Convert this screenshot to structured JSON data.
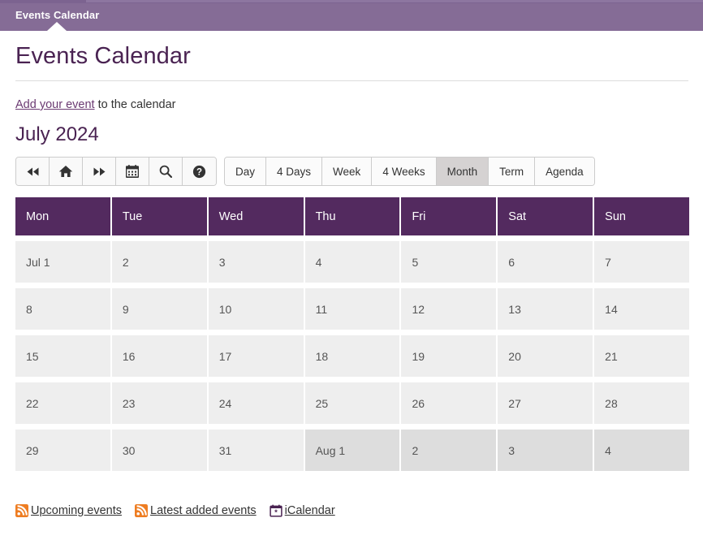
{
  "topbar": {
    "tab_label": "Events Calendar",
    "background_color": "#856c96"
  },
  "page": {
    "title": "Events Calendar",
    "add_event_link": "Add your event",
    "add_event_suffix": " to the calendar",
    "month_title": "July 2024",
    "heading_color": "#4a2352"
  },
  "icon_toolbar": {
    "buttons": [
      {
        "name": "previous-button",
        "icon": "fast-backward-icon"
      },
      {
        "name": "home-button",
        "icon": "home-icon"
      },
      {
        "name": "next-button",
        "icon": "fast-forward-icon"
      },
      {
        "name": "date-picker-button",
        "icon": "calendar-icon"
      },
      {
        "name": "search-button",
        "icon": "search-icon"
      },
      {
        "name": "help-button",
        "icon": "help-circle-icon"
      }
    ]
  },
  "view_toolbar": {
    "buttons": [
      {
        "label": "Day",
        "active": false
      },
      {
        "label": "4 Days",
        "active": false
      },
      {
        "label": "Week",
        "active": false
      },
      {
        "label": "4 Weeks",
        "active": false
      },
      {
        "label": "Month",
        "active": true
      },
      {
        "label": "Term",
        "active": false
      },
      {
        "label": "Agenda",
        "active": false
      }
    ],
    "active_background": "#d5d2d2"
  },
  "calendar": {
    "header_color": "#532a5f",
    "day_headers": [
      "Mon",
      "Tue",
      "Wed",
      "Thu",
      "Fri",
      "Sat",
      "Sun"
    ],
    "weeks": [
      [
        {
          "label": "Jul 1",
          "other_month": false
        },
        {
          "label": "2",
          "other_month": false
        },
        {
          "label": "3",
          "other_month": false
        },
        {
          "label": "4",
          "other_month": false
        },
        {
          "label": "5",
          "other_month": false
        },
        {
          "label": "6",
          "other_month": false
        },
        {
          "label": "7",
          "other_month": false
        }
      ],
      [
        {
          "label": "8",
          "other_month": false
        },
        {
          "label": "9",
          "other_month": false
        },
        {
          "label": "10",
          "other_month": false
        },
        {
          "label": "11",
          "other_month": false
        },
        {
          "label": "12",
          "other_month": false
        },
        {
          "label": "13",
          "other_month": false
        },
        {
          "label": "14",
          "other_month": false
        }
      ],
      [
        {
          "label": "15",
          "other_month": false
        },
        {
          "label": "16",
          "other_month": false
        },
        {
          "label": "17",
          "other_month": false
        },
        {
          "label": "18",
          "other_month": false
        },
        {
          "label": "19",
          "other_month": false
        },
        {
          "label": "20",
          "other_month": false
        },
        {
          "label": "21",
          "other_month": false
        }
      ],
      [
        {
          "label": "22",
          "other_month": false
        },
        {
          "label": "23",
          "other_month": false
        },
        {
          "label": "24",
          "other_month": false
        },
        {
          "label": "25",
          "other_month": false
        },
        {
          "label": "26",
          "other_month": false
        },
        {
          "label": "27",
          "other_month": false
        },
        {
          "label": "28",
          "other_month": false
        }
      ],
      [
        {
          "label": "29",
          "other_month": false
        },
        {
          "label": "30",
          "other_month": false
        },
        {
          "label": "31",
          "other_month": false
        },
        {
          "label": "Aug 1",
          "other_month": true
        },
        {
          "label": "2",
          "other_month": true
        },
        {
          "label": "3",
          "other_month": true
        },
        {
          "label": "4",
          "other_month": true
        }
      ]
    ]
  },
  "footer": {
    "links": [
      {
        "label": "Upcoming events",
        "icon": "rss-icon"
      },
      {
        "label": "Latest added events",
        "icon": "rss-icon"
      },
      {
        "label": "iCalendar",
        "icon": "ical-calendar-icon"
      }
    ],
    "rss_color": "#ee7d22"
  }
}
